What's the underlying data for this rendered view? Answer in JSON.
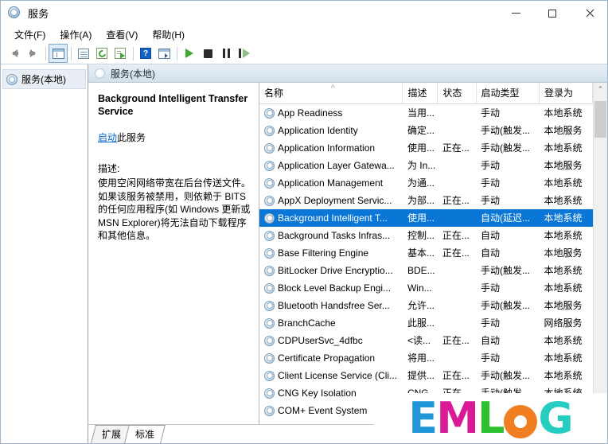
{
  "window": {
    "title": "服务",
    "icon": "services-gear-icon",
    "controls": {
      "minimize": "–",
      "maximize": "□",
      "close": "✕"
    }
  },
  "menubar": {
    "items": [
      {
        "name": "file",
        "label": "文件(F)"
      },
      {
        "name": "action",
        "label": "操作(A)"
      },
      {
        "name": "view",
        "label": "查看(V)"
      },
      {
        "name": "help",
        "label": "帮助(H)"
      }
    ]
  },
  "toolbar": {
    "buttons": [
      {
        "name": "back",
        "icon": "back-arrow-icon",
        "title": "后退"
      },
      {
        "name": "forward",
        "icon": "forward-arrow-icon",
        "title": "前进"
      },
      {
        "name": "show-hide-tree",
        "icon": "console-tree-icon",
        "title": "显示/隐藏控制台树"
      },
      {
        "name": "properties",
        "icon": "properties-icon",
        "title": "属性"
      },
      {
        "name": "refresh",
        "icon": "refresh-icon",
        "title": "刷新"
      },
      {
        "name": "export-list",
        "icon": "export-list-icon",
        "title": "导出列表"
      },
      {
        "name": "help",
        "icon": "help-icon",
        "title": "帮助"
      },
      {
        "name": "detail-view",
        "icon": "detail-view-icon",
        "title": "详细信息"
      },
      {
        "name": "start-service",
        "icon": "play-icon",
        "title": "启动服务"
      },
      {
        "name": "stop-service",
        "icon": "stop-icon",
        "title": "停止服务"
      },
      {
        "name": "pause-service",
        "icon": "pause-icon",
        "title": "暂停服务"
      },
      {
        "name": "restart-service",
        "icon": "restart-icon",
        "title": "重启服务"
      }
    ]
  },
  "tree": {
    "items": [
      {
        "name": "services-local",
        "label": "服务(本地)",
        "icon": "services-gear-icon",
        "selected": true
      }
    ]
  },
  "pane": {
    "header": "服务(本地)",
    "header_icon": "services-gear-icon"
  },
  "detail": {
    "title": "Background Intelligent Transfer Service",
    "action_link": "启动",
    "action_suffix": "此服务",
    "desc_label": "描述:",
    "description": "使用空闲网络带宽在后台传送文件。如果该服务被禁用，则依赖于 BITS 的任何应用程序(如 Windows 更新或 MSN Explorer)将无法自动下载程序和其他信息。"
  },
  "table": {
    "columns": [
      {
        "name": "col-name",
        "label": "名称",
        "sorted": "asc"
      },
      {
        "name": "col-description",
        "label": "描述"
      },
      {
        "name": "col-status",
        "label": "状态"
      },
      {
        "name": "col-startup-type",
        "label": "启动类型"
      },
      {
        "name": "col-logon-as",
        "label": "登录为"
      }
    ],
    "rows": [
      {
        "name": "App Readiness",
        "description": "当用...",
        "status": "",
        "startup": "手动",
        "logon": "本地系统",
        "selected": false
      },
      {
        "name": "Application Identity",
        "description": "确定...",
        "status": "",
        "startup": "手动(触发...",
        "logon": "本地服务",
        "selected": false
      },
      {
        "name": "Application Information",
        "description": "使用...",
        "status": "正在...",
        "startup": "手动(触发...",
        "logon": "本地系统",
        "selected": false
      },
      {
        "name": "Application Layer Gatewa...",
        "description": "为 In...",
        "status": "",
        "startup": "手动",
        "logon": "本地服务",
        "selected": false
      },
      {
        "name": "Application Management",
        "description": "为通...",
        "status": "",
        "startup": "手动",
        "logon": "本地系统",
        "selected": false
      },
      {
        "name": "AppX Deployment Servic...",
        "description": "为部...",
        "status": "正在...",
        "startup": "手动",
        "logon": "本地系统",
        "selected": false
      },
      {
        "name": "Background Intelligent T...",
        "description": "使用...",
        "status": "",
        "startup": "自动(延迟...",
        "logon": "本地系统",
        "selected": true
      },
      {
        "name": "Background Tasks Infras...",
        "description": "控制...",
        "status": "正在...",
        "startup": "自动",
        "logon": "本地系统",
        "selected": false
      },
      {
        "name": "Base Filtering Engine",
        "description": "基本...",
        "status": "正在...",
        "startup": "自动",
        "logon": "本地服务",
        "selected": false
      },
      {
        "name": "BitLocker Drive Encryptio...",
        "description": "BDE...",
        "status": "",
        "startup": "手动(触发...",
        "logon": "本地系统",
        "selected": false
      },
      {
        "name": "Block Level Backup Engi...",
        "description": "Win...",
        "status": "",
        "startup": "手动",
        "logon": "本地系统",
        "selected": false
      },
      {
        "name": "Bluetooth Handsfree Ser...",
        "description": "允许...",
        "status": "",
        "startup": "手动(触发...",
        "logon": "本地服务",
        "selected": false
      },
      {
        "name": "BranchCache",
        "description": "此服...",
        "status": "",
        "startup": "手动",
        "logon": "网络服务",
        "selected": false
      },
      {
        "name": "CDPUserSvc_4dfbc",
        "description": "<读...",
        "status": "正在...",
        "startup": "自动",
        "logon": "本地系统",
        "selected": false
      },
      {
        "name": "Certificate Propagation",
        "description": "将用...",
        "status": "",
        "startup": "手动",
        "logon": "本地系统",
        "selected": false
      },
      {
        "name": "Client License Service (Cli...",
        "description": "提供...",
        "status": "正在...",
        "startup": "手动(触发...",
        "logon": "本地系统",
        "selected": false
      },
      {
        "name": "CNG Key Isolation",
        "description": "CNG...",
        "status": "正在...",
        "startup": "手动(触发...",
        "logon": "本地系统",
        "selected": false
      },
      {
        "name": "COM+ Event System",
        "description": "",
        "status": "",
        "startup": "",
        "logon": "",
        "selected": false
      }
    ]
  },
  "tabs": [
    {
      "name": "tab-extended",
      "label": "扩展",
      "active": false
    },
    {
      "name": "tab-standard",
      "label": "标准",
      "active": true
    }
  ],
  "watermark": {
    "letters": [
      {
        "char": "E",
        "color": "#2196d9"
      },
      {
        "char": "M",
        "color": "#d91a96"
      },
      {
        "char": "L",
        "color": "#2fc02f"
      },
      {
        "char": "O",
        "color": "#ef7f21"
      },
      {
        "char": "G",
        "color": "#25ccc0"
      }
    ]
  },
  "colors": {
    "selection": "#0a76d6",
    "link": "#0066cc"
  }
}
